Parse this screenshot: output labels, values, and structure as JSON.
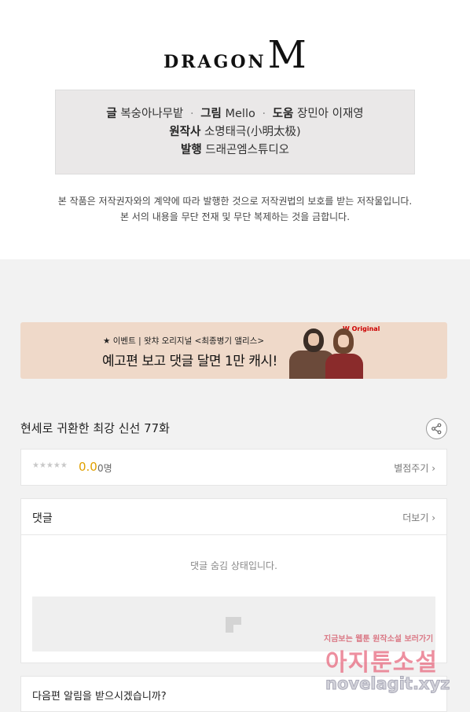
{
  "header": {
    "logo_text": "DRAGON",
    "logo_m": "M"
  },
  "credits": {
    "writer_label": "글",
    "writer": "복숭아나무밭",
    "artist_label": "그림",
    "artist": "Mello",
    "assist_label": "도움",
    "assist": "장민아 이재영",
    "original_label": "원작사",
    "original": "소명태극(小明太极)",
    "publisher_label": "발행",
    "publisher": "드래곤엠스튜디오",
    "separator": "·"
  },
  "notice": {
    "line1": "본 작품은 저작권자와의 계약에 따라 발행한 것으로 저작권법의 보호를 받는 저작물입니다.",
    "line2": "본 서의 내용을 무단 전재 및 무단 복제하는 것을 금합니다."
  },
  "banner": {
    "small_text": "★ 이벤트 | 왓챠 오리지널 <최종병기 앨리스>",
    "big_text": "예고편 보고 댓글 달면 1만 캐시!",
    "brand": "W Original"
  },
  "episode": {
    "title": "현세로 귀환한 최강 신선 77화"
  },
  "rating": {
    "stars": "★★★★★",
    "score": "0.0",
    "count": "0명",
    "rate_link": "별점주기 ›"
  },
  "comments": {
    "title": "댓글",
    "more_link": "더보기 ›",
    "hidden_message": "댓글 숨김 상태입니다."
  },
  "notify": {
    "question": "다음편 알림을 받으시겠습니까?"
  },
  "watermark": {
    "top": "지금보는 웹툰 원작소설 보러가기",
    "big": "아지툰소설",
    "url": "novelagit.xyz"
  }
}
